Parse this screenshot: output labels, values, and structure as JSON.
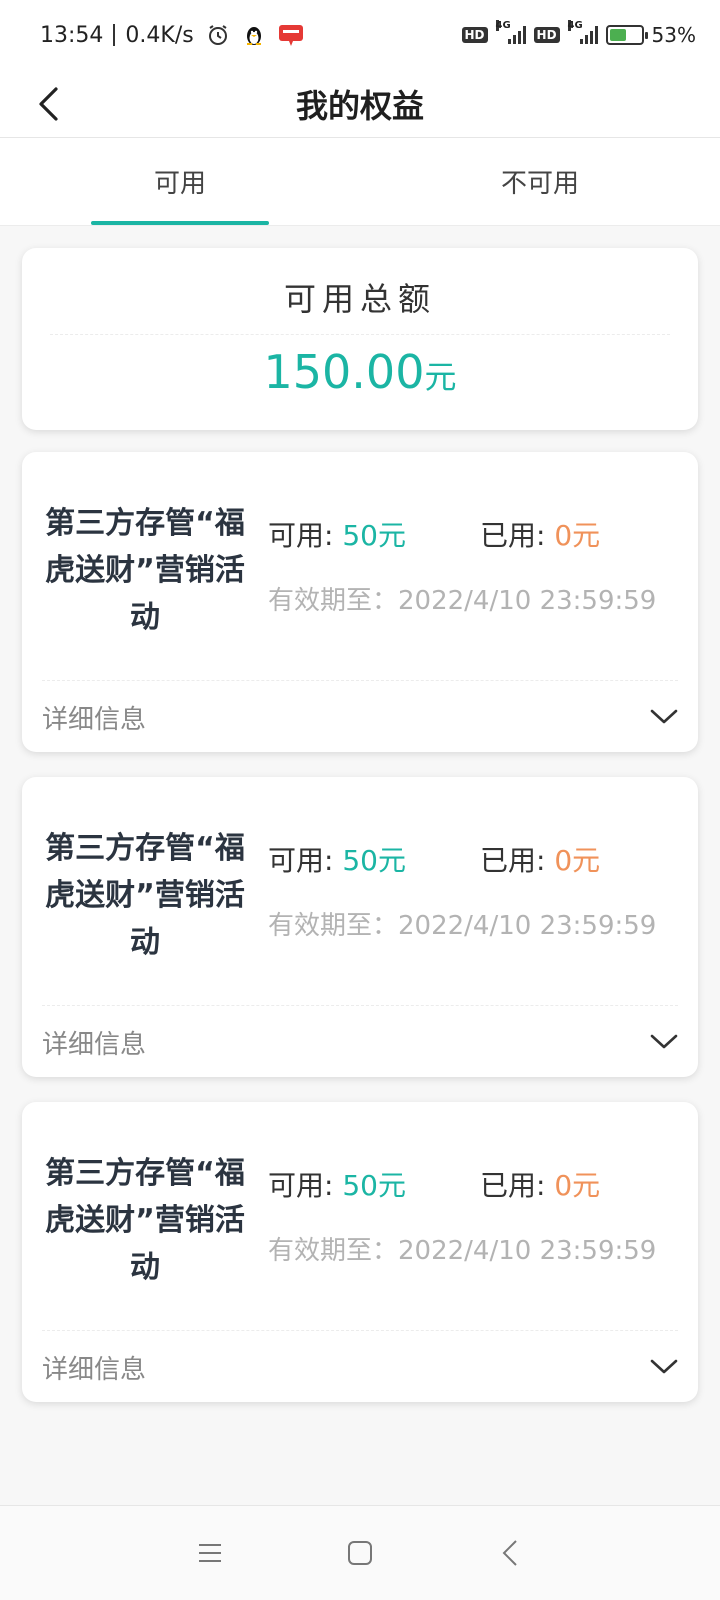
{
  "status_bar": {
    "time": "13:54",
    "speed": "0.4K/s",
    "hd_label": "HD",
    "network_label": "4G",
    "battery": "53%",
    "battery_level": 0.53,
    "icons": [
      "alarm-icon",
      "qq-penguin-icon",
      "app-notification-icon",
      "signal-icon",
      "battery-icon"
    ]
  },
  "header": {
    "title": "我的权益",
    "back_icon": "chevron-left-icon"
  },
  "tabs": [
    {
      "label": "可用",
      "active": true
    },
    {
      "label": "不可用",
      "active": false
    }
  ],
  "summary": {
    "label": "可用总额",
    "amount": "150.00",
    "unit": "元"
  },
  "coupons": [
    {
      "name": "第三方存管“福虎送财”营销活动",
      "available_label": "可用: ",
      "available_value": "50元",
      "used_label": "已用: ",
      "used_value": "0元",
      "expiry": "有效期至：2022/4/10 23:59:59",
      "details_label": "详细信息"
    },
    {
      "name": "第三方存管“福虎送财”营销活动",
      "available_label": "可用: ",
      "available_value": "50元",
      "used_label": "已用: ",
      "used_value": "0元",
      "expiry": "有效期至：2022/4/10 23:59:59",
      "details_label": "详细信息"
    },
    {
      "name": "第三方存管“福虎送财”营销活动",
      "available_label": "可用: ",
      "available_value": "50元",
      "used_label": "已用: ",
      "used_value": "0元",
      "expiry": "有效期至：2022/4/10 23:59:59",
      "details_label": "详细信息"
    }
  ],
  "bottom_nav": [
    "menu-icon",
    "home-square-icon",
    "back-triangle-icon"
  ],
  "colors": {
    "accent": "#1bb5a4",
    "used": "#f0925a",
    "muted": "#b3b3b3",
    "title": "#2b3440"
  }
}
